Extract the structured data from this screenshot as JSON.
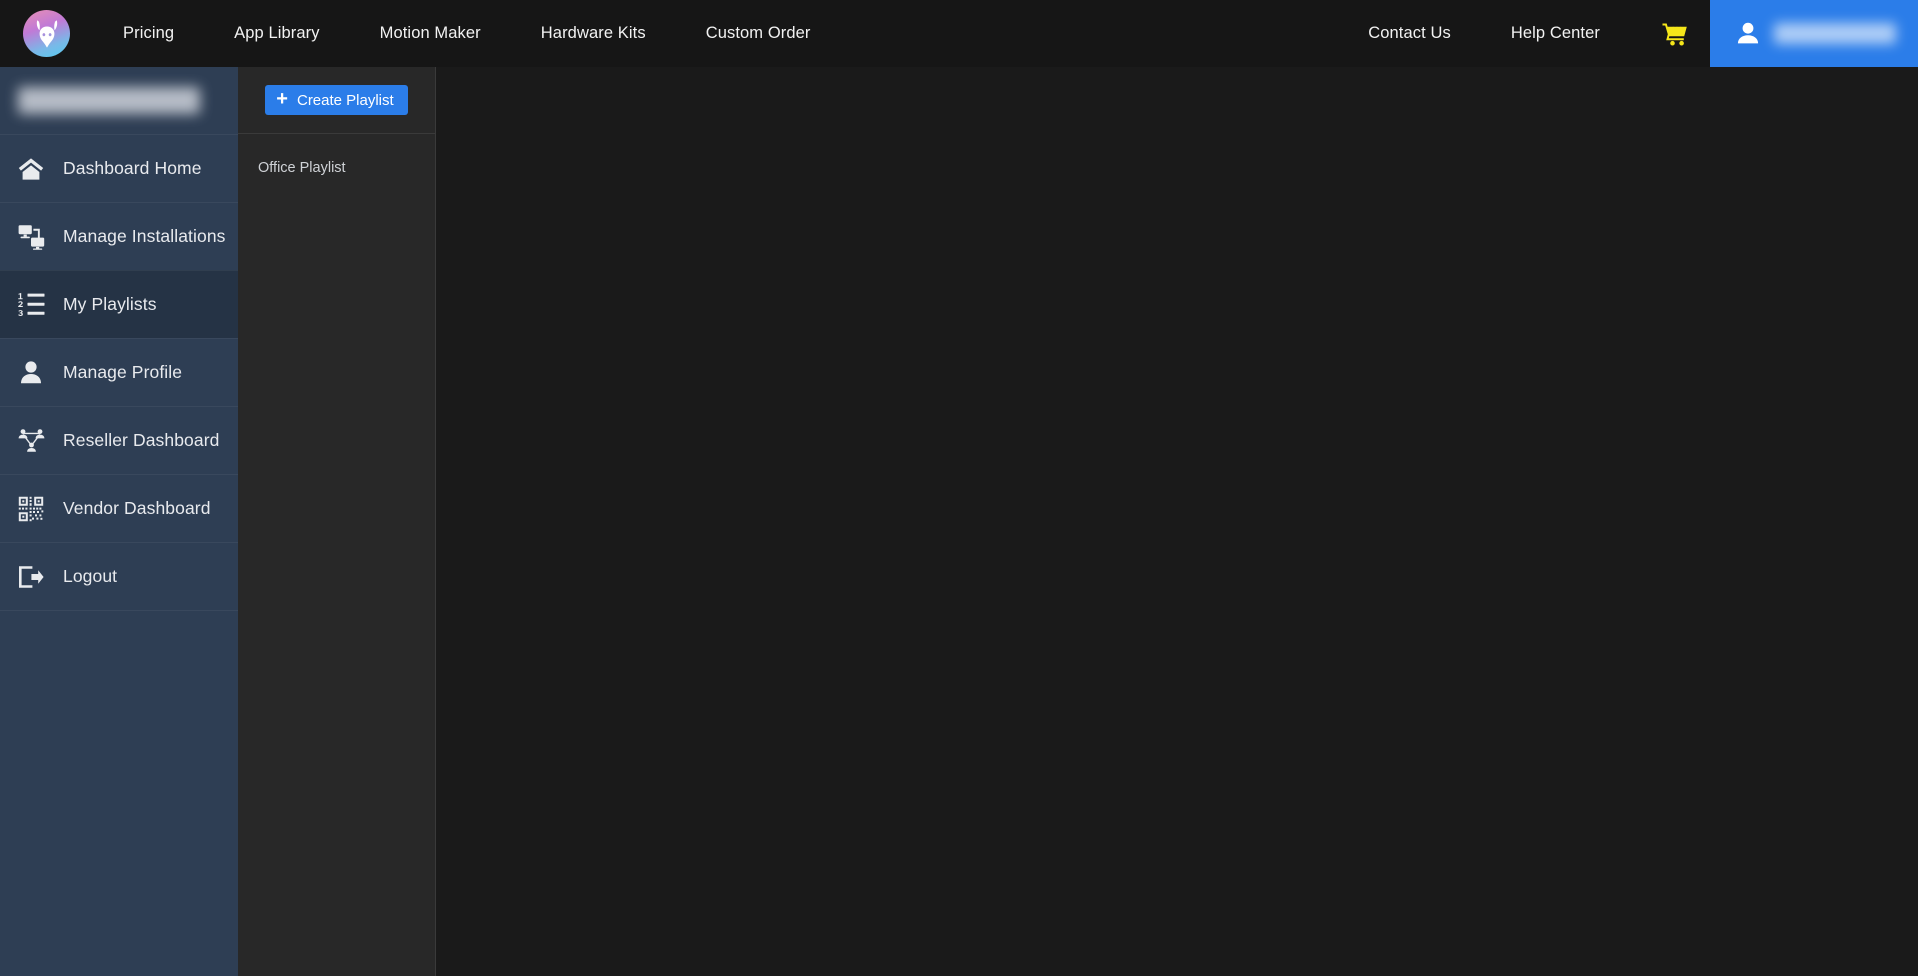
{
  "topbar": {
    "logo_icon": "gazelle-head-logo-icon",
    "nav_links": [
      {
        "label": "Pricing"
      },
      {
        "label": "App Library"
      },
      {
        "label": "Motion Maker"
      },
      {
        "label": "Hardware Kits"
      },
      {
        "label": "Custom Order"
      }
    ],
    "right_links": [
      {
        "label": "Contact Us"
      },
      {
        "label": "Help Center"
      }
    ],
    "cart_icon": "shopping-cart-icon",
    "cart_icon_color": "#f5e61a",
    "account": {
      "icon": "user-person-icon",
      "username": "",
      "username_redacted": true,
      "background_color": "#2b7de9"
    },
    "background_color": "#161616"
  },
  "sidebar": {
    "background_color": "#2e3e54",
    "active_color": "#253345",
    "username": "",
    "username_redacted": true,
    "items": [
      {
        "label": "Dashboard Home",
        "icon": "home-icon",
        "active": false
      },
      {
        "label": "Manage Installations",
        "icon": "screens-network-icon",
        "active": false
      },
      {
        "label": "My Playlists",
        "icon": "numbered-list-icon",
        "active": true
      },
      {
        "label": "Manage Profile",
        "icon": "person-icon",
        "active": false
      },
      {
        "label": "Reseller Dashboard",
        "icon": "network-share-icon",
        "active": false
      },
      {
        "label": "Vendor Dashboard",
        "icon": "qr-code-icon",
        "active": false
      },
      {
        "label": "Logout",
        "icon": "logout-arrow-icon",
        "active": false
      }
    ]
  },
  "playlist_panel": {
    "background_color": "#282828",
    "create_button": {
      "label": "Create Playlist",
      "icon": "plus-icon",
      "color": "#2b7de9"
    },
    "playlists": [
      {
        "name": "Office Playlist"
      }
    ]
  },
  "main": {
    "background_color": "#1a1a1a",
    "content": ""
  }
}
